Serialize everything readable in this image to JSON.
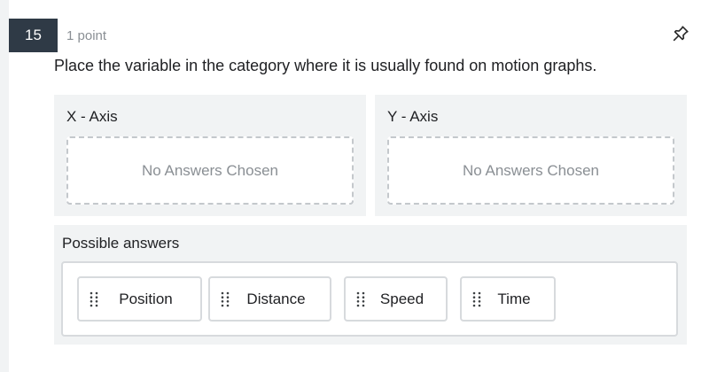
{
  "question": {
    "number": "15",
    "points": "1 point",
    "prompt": "Place the variable in the category where it is usually found on motion graphs."
  },
  "categories": [
    {
      "title": "X - Axis",
      "empty_text": "No Answers Chosen"
    },
    {
      "title": "Y - Axis",
      "empty_text": "No Answers Chosen"
    }
  ],
  "pool": {
    "title": "Possible answers",
    "answers": [
      {
        "label": "Position"
      },
      {
        "label": "Distance"
      },
      {
        "label": "Speed"
      },
      {
        "label": "Time"
      }
    ]
  },
  "icons": {
    "pin": "pin-icon",
    "drag_handle": "drag-handle-icon"
  },
  "colors": {
    "question_badge": "#2f3a46",
    "panel_background": "#f1f3f4",
    "muted_text": "#8a8f94",
    "border": "#d7dadd"
  }
}
